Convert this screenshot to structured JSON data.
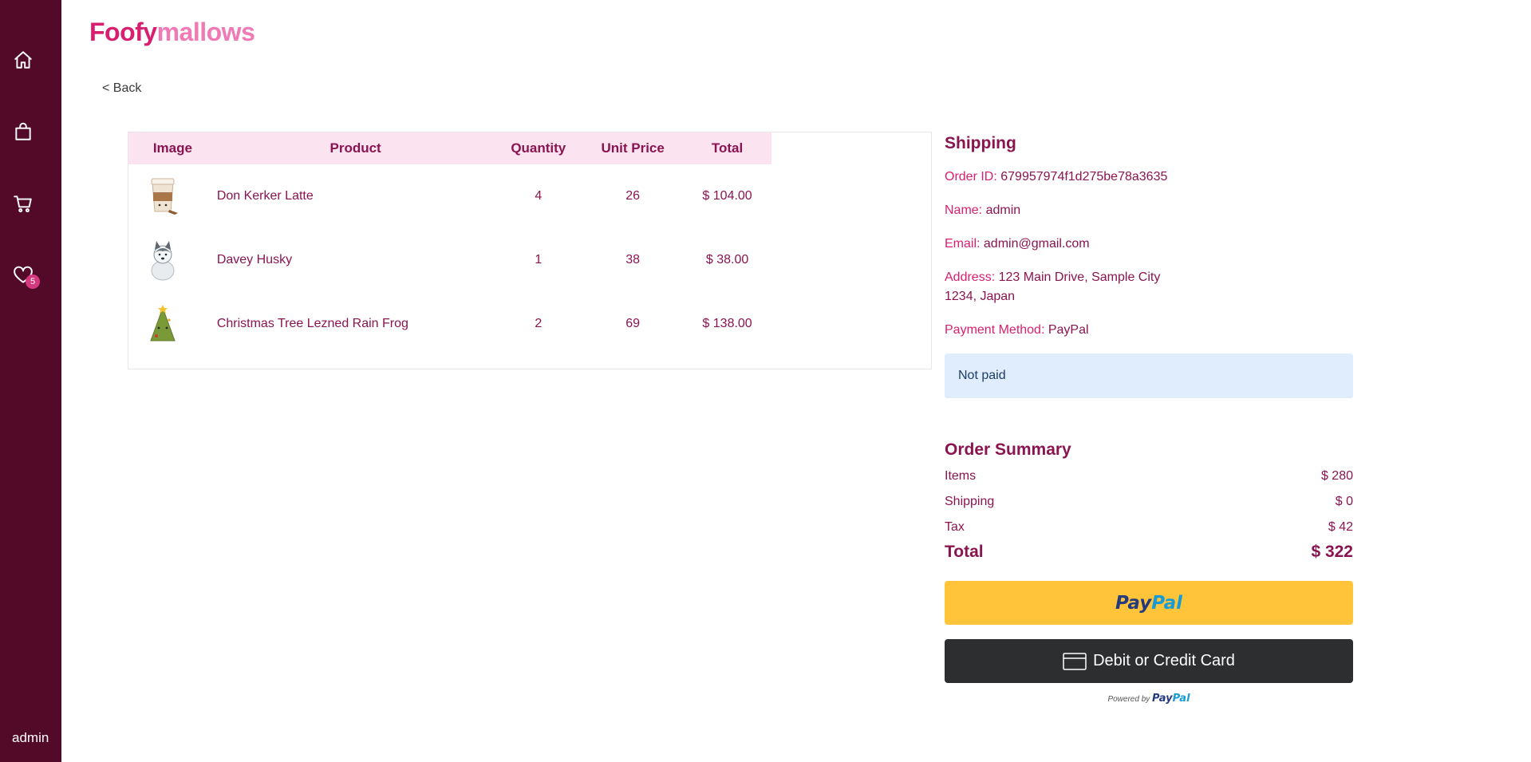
{
  "sidebar": {
    "icons": [
      "home-icon",
      "shopping-bag-icon",
      "cart-icon",
      "heart-icon"
    ],
    "wishlist_count": "5",
    "user": "admin"
  },
  "logo": {
    "part1": "Foofy",
    "part2": "mallows",
    "color1": "#d81f6f",
    "color2": "#f07ab6"
  },
  "back_label": "< Back",
  "table": {
    "headers": [
      "Image",
      "Product",
      "Quantity",
      "Unit Price",
      "Total"
    ],
    "rows": [
      {
        "image": "latte-cup-plush",
        "product": "Don Kerker Latte",
        "quantity": "4",
        "unit_price": "26",
        "total": "$ 104.00"
      },
      {
        "image": "husky-plush",
        "product": "Davey Husky",
        "quantity": "1",
        "unit_price": "38",
        "total": "$ 38.00"
      },
      {
        "image": "christmas-tree-plush",
        "product": "Christmas Tree Lezned Rain Frog",
        "quantity": "2",
        "unit_price": "69",
        "total": "$ 138.00"
      }
    ]
  },
  "shipping": {
    "title": "Shipping",
    "order_id_label": "Order ID:",
    "order_id": "679957974f1d275be78a3635",
    "name_label": "Name:",
    "name": "admin",
    "email_label": "Email:",
    "email": "admin@gmail.com",
    "address_label": "Address:",
    "address_line1": "123 Main Drive, Sample City",
    "address_line2": "1234, Japan",
    "payment_label": "Payment Method:",
    "payment": "PayPal",
    "status": "Not paid"
  },
  "summary": {
    "title": "Order Summary",
    "items_label": "Items",
    "items_value": "$ 280",
    "shipping_label": "Shipping",
    "shipping_value": "$ 0",
    "tax_label": "Tax",
    "tax_value": "$ 42",
    "total_label": "Total",
    "total_value": "$ 322"
  },
  "payment_buttons": {
    "paypal_a": "Pay",
    "paypal_b": "Pal",
    "card_label": "Debit or Credit Card",
    "powered_by": "Powered by",
    "paypal_color": "#ffc439",
    "card_color": "#2c2e2f"
  }
}
